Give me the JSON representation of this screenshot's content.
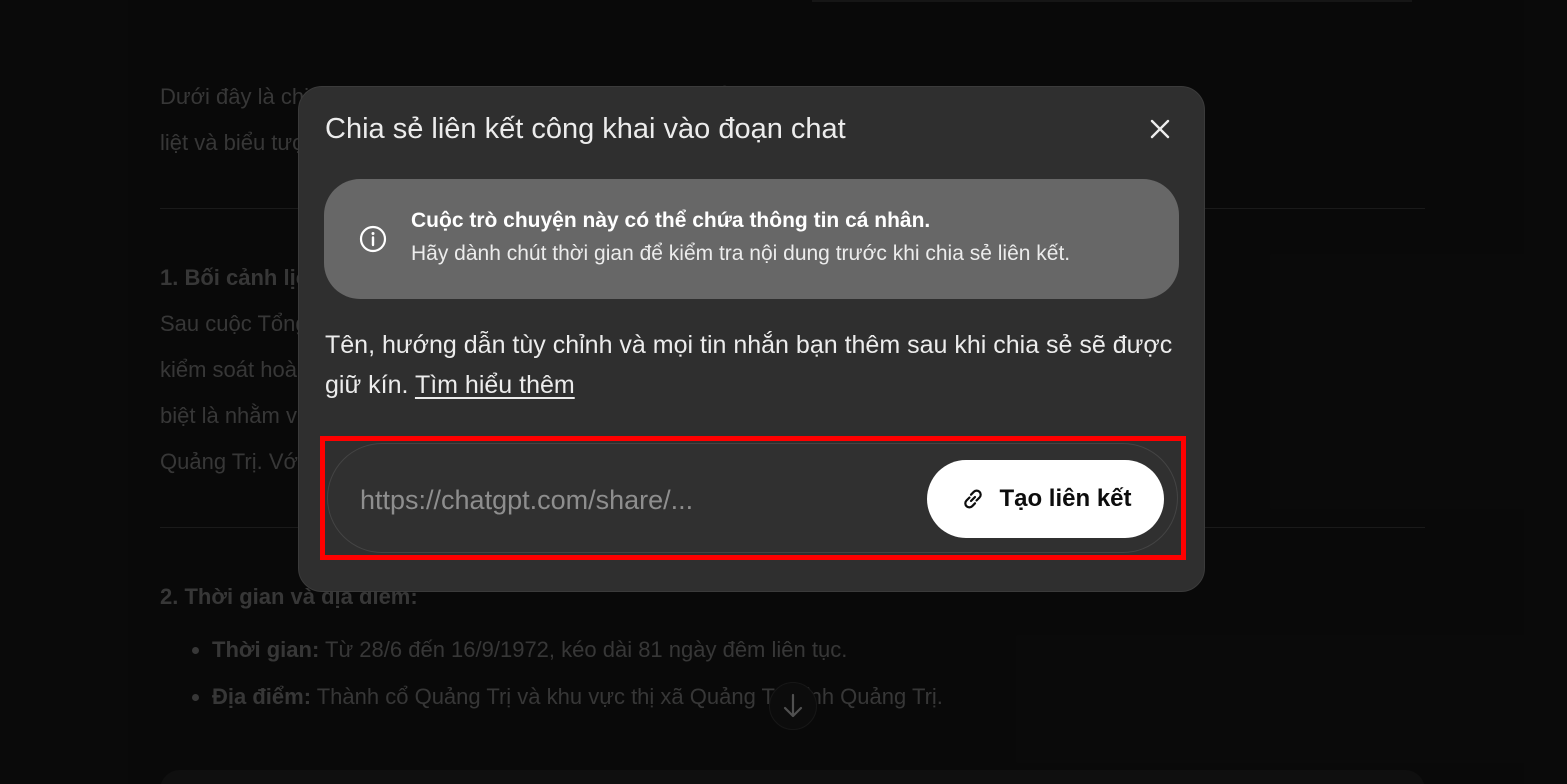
{
  "background_chat": {
    "intro_line1": "Dưới đây là chi tiết về trận chiến 81 ngày đêm ở Thành cổ Quảng Trị, một trong những trận chiến ác",
    "intro_line2": "liệt và biểu tượng nhất của chiến tranh Việt Nam.",
    "section1_heading": "1. Bối cảnh lịch sử:",
    "section1_line1": "Sau cuộc Tổng tiến công chiến lược năm 1972, quân Giải phóng đã",
    "section1_line2": "kiểm soát hoàn toàn tỉnh Quảng Trị. Mỹ và chính quyền Sài Gòn tăng cường viện trợ và quân sự, đặc",
    "section1_line3": "biệt là nhằm vào Thành cổ, trong nỗ lực quyết tâm tái chiếm",
    "section1_line4": "Quảng Trị. Với sự hỗ trợ...",
    "section2_heading": "2. Thời gian và địa điểm:",
    "bullets": [
      {
        "label": "Thời gian:",
        "text": " Từ 28/6 đến 16/9/1972, kéo dài 81 ngày đêm liên tục."
      },
      {
        "label": "Địa điểm:",
        "text": " Thành cổ Quảng Trị và khu vực thị xã Quảng Trị, tỉnh Quảng Trị."
      }
    ]
  },
  "modal": {
    "title": "Chia sẻ liên kết công khai vào đoạn chat",
    "notice": {
      "title": "Cuộc trò chuyện này có thể chứa thông tin cá nhân.",
      "body": "Hãy dành chút thời gian để kiểm tra nội dung trước khi chia sẻ liên kết."
    },
    "description": "Tên, hướng dẫn tùy chỉnh và mọi tin nhắn bạn thêm sau khi chia sẻ sẽ được giữ kín.",
    "learn_more": "Tìm hiểu thêm",
    "url_placeholder": "https://chatgpt.com/share/...",
    "create_button_label": "Tạo liên kết"
  },
  "icons": {
    "close": "close-icon",
    "info": "info-icon",
    "link": "link-icon",
    "scroll_down": "arrow-down-icon"
  },
  "colors": {
    "modal_bg": "#2f2f2f",
    "notice_bg": "#676767",
    "highlight": "#ff0000",
    "button_bg": "#ffffff"
  }
}
